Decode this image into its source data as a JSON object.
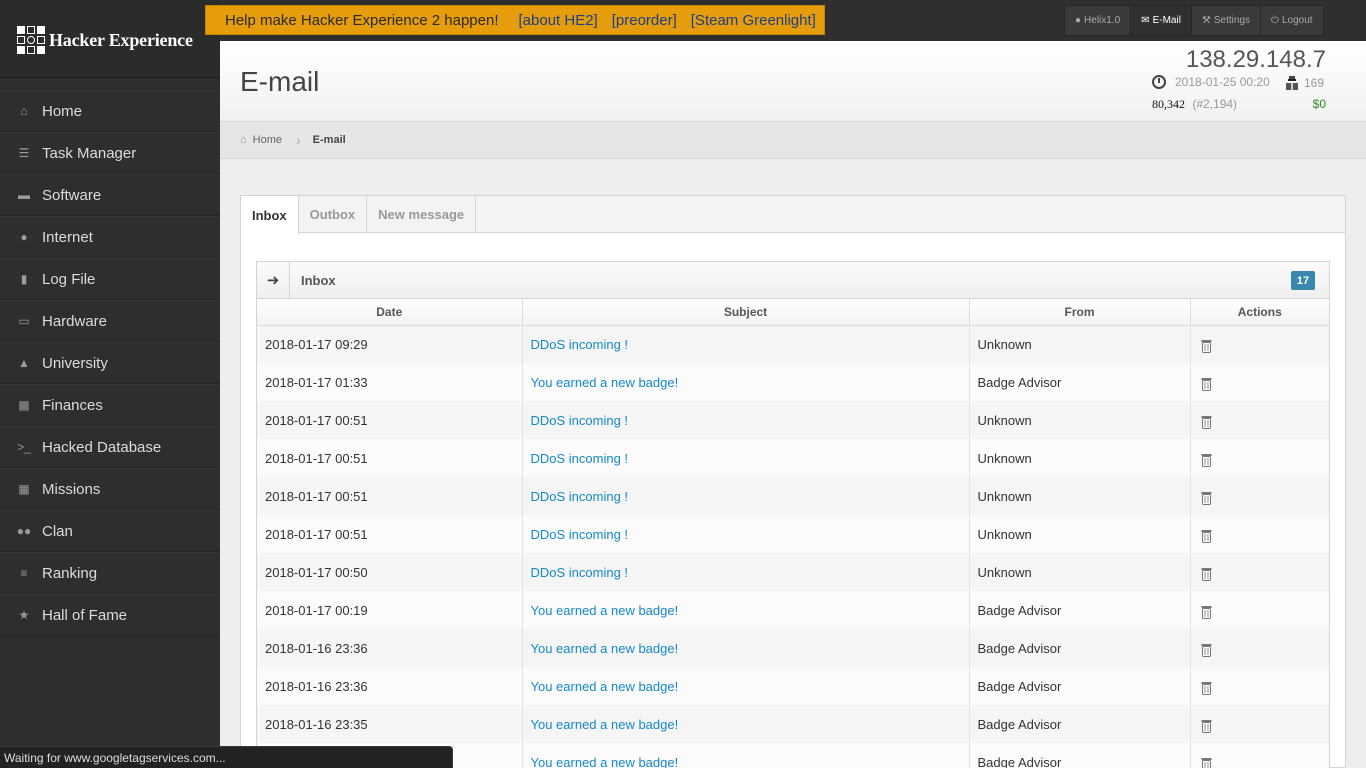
{
  "app": {
    "name": "Hacker Experience"
  },
  "banner": {
    "message": "Help make Hacker Experience 2 happen!",
    "links": [
      "[about HE2]",
      "[preorder]",
      "[Steam Greenlight]"
    ]
  },
  "usernav": {
    "items": [
      {
        "label": "Helix1.0",
        "icon": "user-icon"
      },
      {
        "label": "E-Mail",
        "icon": "envelope-icon"
      },
      {
        "label": "Settings",
        "icon": "wrench-icon"
      },
      {
        "label": "Logout",
        "icon": "power-icon"
      }
    ]
  },
  "sidebar": {
    "items": [
      {
        "label": "Home",
        "icon": "home-icon"
      },
      {
        "label": "Task Manager",
        "icon": "tasks-icon"
      },
      {
        "label": "Software",
        "icon": "folder-open-icon"
      },
      {
        "label": "Internet",
        "icon": "globe-icon"
      },
      {
        "label": "Log File",
        "icon": "book-icon"
      },
      {
        "label": "Hardware",
        "icon": "desktop-icon"
      },
      {
        "label": "University",
        "icon": "flask-icon"
      },
      {
        "label": "Finances",
        "icon": "briefcase-icon"
      },
      {
        "label": "Hacked Database",
        "icon": "terminal-icon"
      },
      {
        "label": "Missions",
        "icon": "building-icon"
      },
      {
        "label": "Clan",
        "icon": "group-icon"
      },
      {
        "label": "Ranking",
        "icon": "list-icon"
      },
      {
        "label": "Hall of Fame",
        "icon": "star-icon"
      }
    ]
  },
  "header": {
    "title": "E-mail",
    "ip": "138.29.148.7",
    "datetime": "2018-01-25 00:20",
    "reputation": "169",
    "points": "80,342",
    "rank": "(#2,194)",
    "money": "$0"
  },
  "breadcrumb": {
    "home": "Home",
    "current": "E-mail"
  },
  "tabs": [
    {
      "label": "Inbox",
      "active": true
    },
    {
      "label": "Outbox",
      "active": false
    },
    {
      "label": "New message",
      "active": false
    }
  ],
  "inbox": {
    "title": "Inbox",
    "count": "17",
    "columns": [
      "Date",
      "Subject",
      "From",
      "Actions"
    ],
    "rows": [
      {
        "date": "2018-01-17 09:29",
        "subject": "DDoS incoming !",
        "from": "Unknown"
      },
      {
        "date": "2018-01-17 01:33",
        "subject": "You earned a new badge!",
        "from": "Badge Advisor"
      },
      {
        "date": "2018-01-17 00:51",
        "subject": "DDoS incoming !",
        "from": "Unknown"
      },
      {
        "date": "2018-01-17 00:51",
        "subject": "DDoS incoming !",
        "from": "Unknown"
      },
      {
        "date": "2018-01-17 00:51",
        "subject": "DDoS incoming !",
        "from": "Unknown"
      },
      {
        "date": "2018-01-17 00:51",
        "subject": "DDoS incoming !",
        "from": "Unknown"
      },
      {
        "date": "2018-01-17 00:50",
        "subject": "DDoS incoming !",
        "from": "Unknown"
      },
      {
        "date": "2018-01-17 00:19",
        "subject": "You earned a new badge!",
        "from": "Badge Advisor"
      },
      {
        "date": "2018-01-16 23:36",
        "subject": "You earned a new badge!",
        "from": "Badge Advisor"
      },
      {
        "date": "2018-01-16 23:36",
        "subject": "You earned a new badge!",
        "from": "Badge Advisor"
      },
      {
        "date": "2018-01-16 23:35",
        "subject": "You earned a new badge!",
        "from": "Badge Advisor"
      },
      {
        "date": "",
        "subject": "You earned a new badge!",
        "from": "Badge Advisor"
      }
    ]
  },
  "statusbar": {
    "text": "Waiting for www.googletagservices.com..."
  },
  "colors": {
    "banner": "#e59d0b",
    "link": "#1588c8",
    "badge": "#3a87ad",
    "money": "#2e8a25"
  }
}
